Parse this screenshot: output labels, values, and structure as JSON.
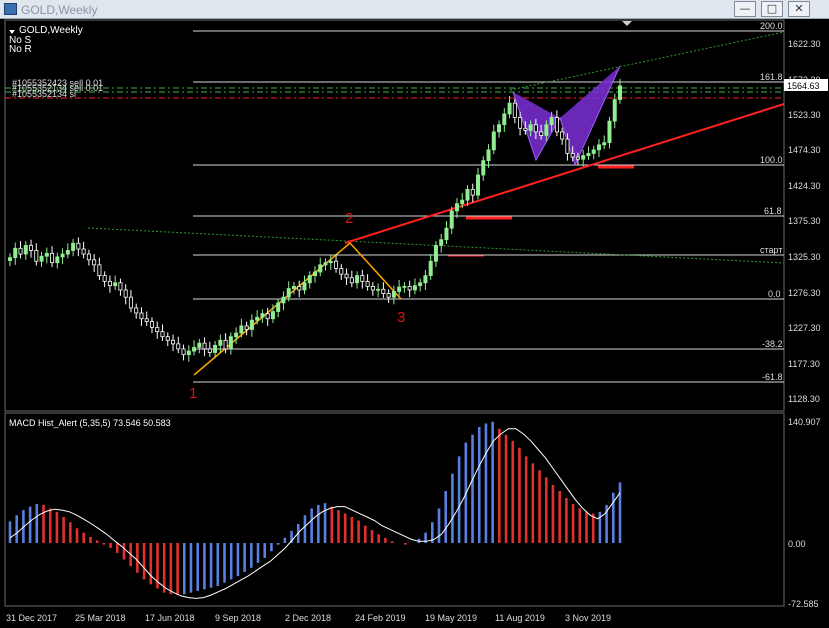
{
  "window": {
    "title": "GOLD,Weekly",
    "buttons": {
      "minimize": "—",
      "maximize": "□",
      "close": "✕"
    }
  },
  "chart_info": {
    "symbol_label": "GOLD,Weekly",
    "line1": "No S",
    "line2": "No R"
  },
  "order_labels": [
    "#1055352423 sell 0.01",
    "#1055352134 sell 0.01",
    "#1055352134 sl"
  ],
  "price_axis": {
    "ticks": [
      "1622.30",
      "1572.30",
      "1523.30",
      "1474.30",
      "1424.30",
      "1375.30",
      "1325.30",
      "1276.30",
      "1227.30",
      "1177.30",
      "1128.30"
    ],
    "current_price": "1564.63"
  },
  "fib_levels": [
    "200.0",
    "161.8",
    "100.0",
    "61.8",
    "старт",
    "0.0",
    "-38.2",
    "-61.8"
  ],
  "wave_labels": [
    "1",
    "2",
    "3"
  ],
  "time_axis": [
    "31 Dec 2017",
    "25 Mar 2018",
    "17 Jun 2018",
    "9 Sep 2018",
    "2 Dec 2018",
    "24 Feb 2019",
    "19 May 2019",
    "11 Aug 2019",
    "3 Nov 2019"
  ],
  "indicator": {
    "name": "MACD Hist_Alert",
    "params": "(5,35,5)",
    "value1": "73.546",
    "value2": "50.583",
    "ticks": [
      "140.907",
      "0.00",
      "-72.585"
    ]
  },
  "colors": {
    "bull": "#90ee90",
    "bear": "#ffffff",
    "trend": "#ff2020",
    "wave": "#ffa500",
    "pattern": "#8a2be2",
    "hist_up": "#5b7fe0",
    "hist_down": "#e23030",
    "signal": "#ffffff",
    "dotted": "#2e9e2e"
  },
  "chart_data": {
    "type": "table",
    "candles_close": [
      1325,
      1338,
      1330,
      1342,
      1335,
      1320,
      1327,
      1331,
      1318,
      1326,
      1330,
      1335,
      1345,
      1337,
      1330,
      1322,
      1315,
      1300,
      1292,
      1286,
      1290,
      1280,
      1270,
      1255,
      1248,
      1240,
      1236,
      1228,
      1222,
      1215,
      1210,
      1205,
      1198,
      1190,
      1195,
      1200,
      1206,
      1198,
      1193,
      1203,
      1210,
      1198,
      1215,
      1220,
      1230,
      1225,
      1238,
      1242,
      1247,
      1240,
      1250,
      1262,
      1270,
      1282,
      1285,
      1280,
      1290,
      1300,
      1305,
      1315,
      1318,
      1320,
      1310,
      1302,
      1297,
      1290,
      1300,
      1292,
      1285,
      1280,
      1281,
      1275,
      1270,
      1278,
      1284,
      1285,
      1280,
      1286,
      1290,
      1300,
      1320,
      1342,
      1350,
      1366,
      1390,
      1400,
      1405,
      1420,
      1412,
      1440,
      1460,
      1475,
      1500,
      1510,
      1525,
      1540,
      1520,
      1505,
      1502,
      1510,
      1500,
      1495,
      1510,
      1520,
      1500,
      1490,
      1470,
      1465,
      1462,
      1467,
      1470,
      1475,
      1482,
      1485,
      1515,
      1545,
      1564
    ],
    "macd_hist": [
      25,
      32,
      38,
      42,
      45,
      44,
      40,
      36,
      30,
      24,
      17,
      12,
      7,
      3,
      -2,
      -6,
      -12,
      -20,
      -28,
      -36,
      -44,
      -50,
      -55,
      -60,
      -62,
      -63,
      -62,
      -60,
      -58,
      -56,
      -54,
      -52,
      -48,
      -44,
      -40,
      -35,
      -30,
      -24,
      -18,
      -10,
      -2,
      6,
      14,
      22,
      32,
      40,
      44,
      46,
      42,
      38,
      34,
      30,
      26,
      20,
      15,
      10,
      6,
      2,
      0,
      -2,
      0,
      5,
      12,
      24,
      40,
      60,
      80,
      100,
      116,
      125,
      134,
      138,
      140,
      132,
      125,
      118,
      110,
      100,
      92,
      84,
      76,
      67,
      60,
      52,
      45,
      40,
      36,
      34,
      36,
      44,
      58,
      70
    ],
    "macd_signal": [
      6,
      12,
      20,
      27,
      33,
      37,
      39,
      38,
      36,
      32,
      27,
      22,
      16,
      10,
      3,
      -4,
      -12,
      -20,
      -30,
      -40,
      -48,
      -55,
      -60,
      -64,
      -66,
      -67,
      -66,
      -63,
      -59,
      -55,
      -50,
      -45,
      -40,
      -34,
      -28,
      -22,
      -14,
      -6,
      4,
      14,
      22,
      30,
      36,
      40,
      42,
      42,
      38,
      34,
      30,
      26,
      20,
      16,
      12,
      8,
      4,
      2,
      2,
      4,
      10,
      22,
      36,
      52,
      70,
      88,
      104,
      118,
      126,
      132,
      132,
      126,
      118,
      108,
      98,
      86,
      74,
      62,
      50,
      40,
      32,
      28,
      34,
      46,
      58
    ]
  }
}
